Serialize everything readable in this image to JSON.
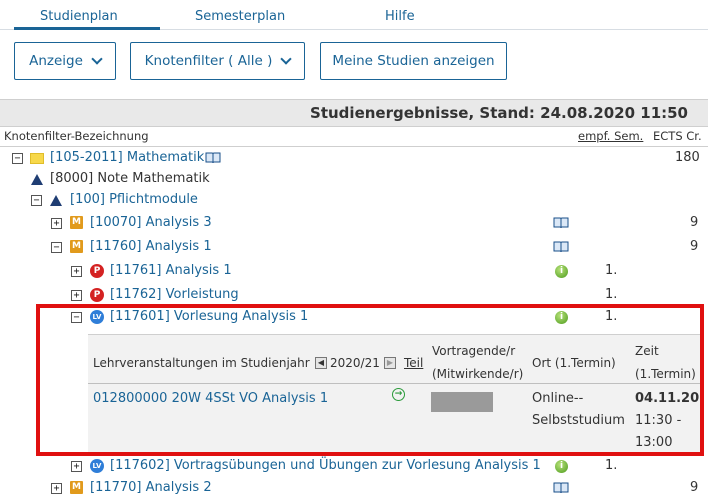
{
  "tabs": [
    {
      "label": "Studienplan",
      "active": true
    },
    {
      "label": "Semesterplan",
      "active": false
    },
    {
      "label": "Hilfe",
      "active": false
    }
  ],
  "toolbar": {
    "anzeige": "Anzeige",
    "knotenfilter": "Knotenfilter ( Alle )",
    "meine_studien": "Meine Studien anzeigen"
  },
  "results": {
    "title": "Studienergebnisse, Stand: 24.08.2020 11:50"
  },
  "columns": {
    "bezeichnung": "Knotenfilter-Bezeichnung",
    "empf_sem": "empf. Sem.",
    "ects": "ECTS Cr."
  },
  "tree": [
    {
      "label": "[105-2011] Mathematik",
      "ects": "180",
      "expander": "−"
    },
    {
      "label": "[8000] Note Mathematik"
    },
    {
      "label": "[100] Pflichtmodule",
      "expander": "−"
    },
    {
      "label": "[10070] Analysis 3",
      "ects": "9",
      "expander": "+",
      "icon": "M"
    },
    {
      "label": "[11760] Analysis 1",
      "ects": "9",
      "expander": "−",
      "icon": "M"
    },
    {
      "label": "[11761] Analysis 1",
      "sem": "1.",
      "expander": "+",
      "icon": "P"
    },
    {
      "label": "[11762] Vorleistung",
      "sem": "1.",
      "expander": "+",
      "icon": "P"
    },
    {
      "label": "[117601] Vorlesung Analysis 1",
      "sem": "1.",
      "expander": "−",
      "icon": "LV"
    },
    {
      "label": "[117602] Vortragsübungen und Übungen zur Vorlesung Analysis 1",
      "sem": "1.",
      "expander": "+",
      "icon": "LV"
    },
    {
      "label": "[11770] Analysis 2",
      "ects": "9",
      "expander": "+",
      "icon": "M"
    }
  ],
  "detail": {
    "h_lv": "Lehrveranstaltungen im Studienjahr",
    "year": "2020/21",
    "teil": "Teil",
    "h_vortragende_1": "Vortragende/r",
    "h_vortragende_2": "(Mitwirkende/r)",
    "h_ort": "Ort (1.Termin)",
    "h_zeit_1": "Zeit",
    "h_zeit_2": "(1.Termin)",
    "course": "012800000 20W 4SSt VO Analysis 1",
    "ort_1": "Online--",
    "ort_2": "Selbststudium",
    "date": "04.11.20",
    "time_1": "11:30 -",
    "time_2": "13:00"
  },
  "icons": {
    "folder": "folder-icon",
    "triangle": "triangle-icon",
    "module": "module-m-icon",
    "exam": "exam-p-icon",
    "lecture": "lecture-lv-icon",
    "book": "book-icon",
    "info": "info-icon"
  },
  "colors": {
    "brand": "#1a6496",
    "highlight": "#e01010",
    "module": "#e19a1c",
    "exam": "#d42222",
    "lecture": "#2f7ed8"
  }
}
